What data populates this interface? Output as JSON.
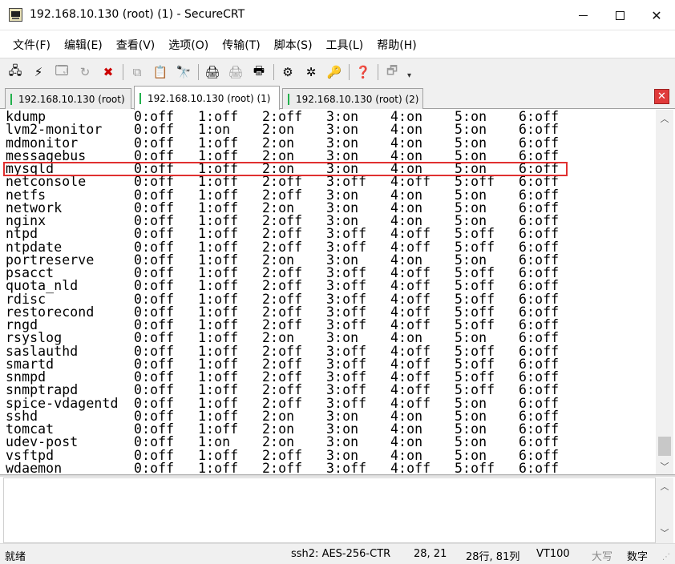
{
  "window": {
    "title": "192.168.10.130 (root) (1) - SecureCRT"
  },
  "menu": [
    "文件(F)",
    "编辑(E)",
    "查看(V)",
    "选项(O)",
    "传输(T)",
    "脚本(S)",
    "工具(L)",
    "帮助(H)"
  ],
  "toolbar_icons": [
    "connect-icon",
    "quick-connect-icon",
    "connect-tab-icon",
    "reconnect-icon",
    "disconnect-icon",
    "copy-icon",
    "paste-icon",
    "find-icon",
    "print-screen-icon",
    "print-selection-icon",
    "print-icon",
    "session-options-icon",
    "global-options-icon",
    "keymap-icon",
    "help-icon",
    "sftp-icon"
  ],
  "tabs": [
    {
      "label": "192.168.10.130 (root)",
      "active": false
    },
    {
      "label": "192.168.10.130 (root) (1)",
      "active": true
    },
    {
      "label": "192.168.10.130 (root) (2)",
      "active": false
    }
  ],
  "terminal_rows": [
    [
      "kdump",
      "0:off",
      "1:off",
      "2:off",
      "3:on",
      "4:on",
      "5:on",
      "6:off"
    ],
    [
      "lvm2-monitor",
      "0:off",
      "1:on",
      "2:on",
      "3:on",
      "4:on",
      "5:on",
      "6:off"
    ],
    [
      "mdmonitor",
      "0:off",
      "1:off",
      "2:on",
      "3:on",
      "4:on",
      "5:on",
      "6:off"
    ],
    [
      "messagebus",
      "0:off",
      "1:off",
      "2:on",
      "3:on",
      "4:on",
      "5:on",
      "6:off"
    ],
    [
      "mysqld",
      "0:off",
      "1:off",
      "2:on",
      "3:on",
      "4:on",
      "5:on",
      "6:off"
    ],
    [
      "netconsole",
      "0:off",
      "1:off",
      "2:off",
      "3:off",
      "4:off",
      "5:off",
      "6:off"
    ],
    [
      "netfs",
      "0:off",
      "1:off",
      "2:off",
      "3:on",
      "4:on",
      "5:on",
      "6:off"
    ],
    [
      "network",
      "0:off",
      "1:off",
      "2:on",
      "3:on",
      "4:on",
      "5:on",
      "6:off"
    ],
    [
      "nginx",
      "0:off",
      "1:off",
      "2:off",
      "3:on",
      "4:on",
      "5:on",
      "6:off"
    ],
    [
      "ntpd",
      "0:off",
      "1:off",
      "2:off",
      "3:off",
      "4:off",
      "5:off",
      "6:off"
    ],
    [
      "ntpdate",
      "0:off",
      "1:off",
      "2:off",
      "3:off",
      "4:off",
      "5:off",
      "6:off"
    ],
    [
      "portreserve",
      "0:off",
      "1:off",
      "2:on",
      "3:on",
      "4:on",
      "5:on",
      "6:off"
    ],
    [
      "psacct",
      "0:off",
      "1:off",
      "2:off",
      "3:off",
      "4:off",
      "5:off",
      "6:off"
    ],
    [
      "quota_nld",
      "0:off",
      "1:off",
      "2:off",
      "3:off",
      "4:off",
      "5:off",
      "6:off"
    ],
    [
      "rdisc",
      "0:off",
      "1:off",
      "2:off",
      "3:off",
      "4:off",
      "5:off",
      "6:off"
    ],
    [
      "restorecond",
      "0:off",
      "1:off",
      "2:off",
      "3:off",
      "4:off",
      "5:off",
      "6:off"
    ],
    [
      "rngd",
      "0:off",
      "1:off",
      "2:off",
      "3:off",
      "4:off",
      "5:off",
      "6:off"
    ],
    [
      "rsyslog",
      "0:off",
      "1:off",
      "2:on",
      "3:on",
      "4:on",
      "5:on",
      "6:off"
    ],
    [
      "saslauthd",
      "0:off",
      "1:off",
      "2:off",
      "3:off",
      "4:off",
      "5:off",
      "6:off"
    ],
    [
      "smartd",
      "0:off",
      "1:off",
      "2:off",
      "3:off",
      "4:off",
      "5:off",
      "6:off"
    ],
    [
      "snmpd",
      "0:off",
      "1:off",
      "2:off",
      "3:off",
      "4:off",
      "5:off",
      "6:off"
    ],
    [
      "snmptrapd",
      "0:off",
      "1:off",
      "2:off",
      "3:off",
      "4:off",
      "5:off",
      "6:off"
    ],
    [
      "spice-vdagentd",
      "0:off",
      "1:off",
      "2:off",
      "3:off",
      "4:off",
      "5:on",
      "6:off"
    ],
    [
      "sshd",
      "0:off",
      "1:off",
      "2:on",
      "3:on",
      "4:on",
      "5:on",
      "6:off"
    ],
    [
      "tomcat",
      "0:off",
      "1:off",
      "2:on",
      "3:on",
      "4:on",
      "5:on",
      "6:off"
    ],
    [
      "udev-post",
      "0:off",
      "1:on",
      "2:on",
      "3:on",
      "4:on",
      "5:on",
      "6:off"
    ],
    [
      "vsftpd",
      "0:off",
      "1:off",
      "2:off",
      "3:on",
      "4:on",
      "5:on",
      "6:off"
    ],
    [
      "wdaemon",
      "0:off",
      "1:off",
      "2:off",
      "3:off",
      "4:off",
      "5:off",
      "6:off"
    ]
  ],
  "highlighted_row": "mysqld",
  "status": {
    "ready": "就绪",
    "cipher": "ssh2: AES-256-CTR",
    "cursor": "28,  21",
    "size": "28行, 81列",
    "term": "VT100",
    "caps": "大写",
    "num": "数字"
  }
}
